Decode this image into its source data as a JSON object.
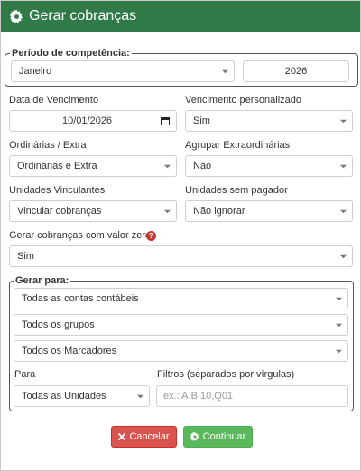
{
  "header": {
    "title": "Gerar cobranças",
    "icon": "gear-icon"
  },
  "periodo": {
    "legend": "Período de competência:",
    "month": "Janeiro",
    "year": "2026"
  },
  "vencimento": {
    "label": "Data de Vencimento",
    "date": "10/01/2026"
  },
  "personalizado": {
    "label": "Vencimento personalizado",
    "value": "Sim"
  },
  "ordinarias": {
    "label": "Ordinárias / Extra",
    "value": "Ordinárias e Extra"
  },
  "agrupar": {
    "label": "Agrupar Extraordinárias",
    "value": "Não"
  },
  "vinculantes": {
    "label": "Unidades Vinculantes",
    "value": "Vincular cobranças"
  },
  "sem_pagador": {
    "label": "Unidades sem pagador",
    "value": "Não ignorar"
  },
  "valor_zero": {
    "label": "Gerar cobranças com valor zero",
    "value": "Sim",
    "help": "?"
  },
  "gerar_para": {
    "legend": "Gerar para:",
    "contas": "Todas as contas contábeis",
    "grupos": "Todos os grupos",
    "marcadores": "Todos os Marcadores",
    "para_label": "Para",
    "para_value": "Todas as Unidades",
    "filtros_label": "Filtros (separados por vírgulas)",
    "filtros_placeholder": "ex.: A,B,10,Q01"
  },
  "buttons": {
    "cancel": "Cancelar",
    "continue": "Continuar"
  },
  "colors": {
    "header": "#2f7a47",
    "cancel": "#d9534f",
    "continue": "#5cb85c",
    "help": "#c0392b"
  }
}
